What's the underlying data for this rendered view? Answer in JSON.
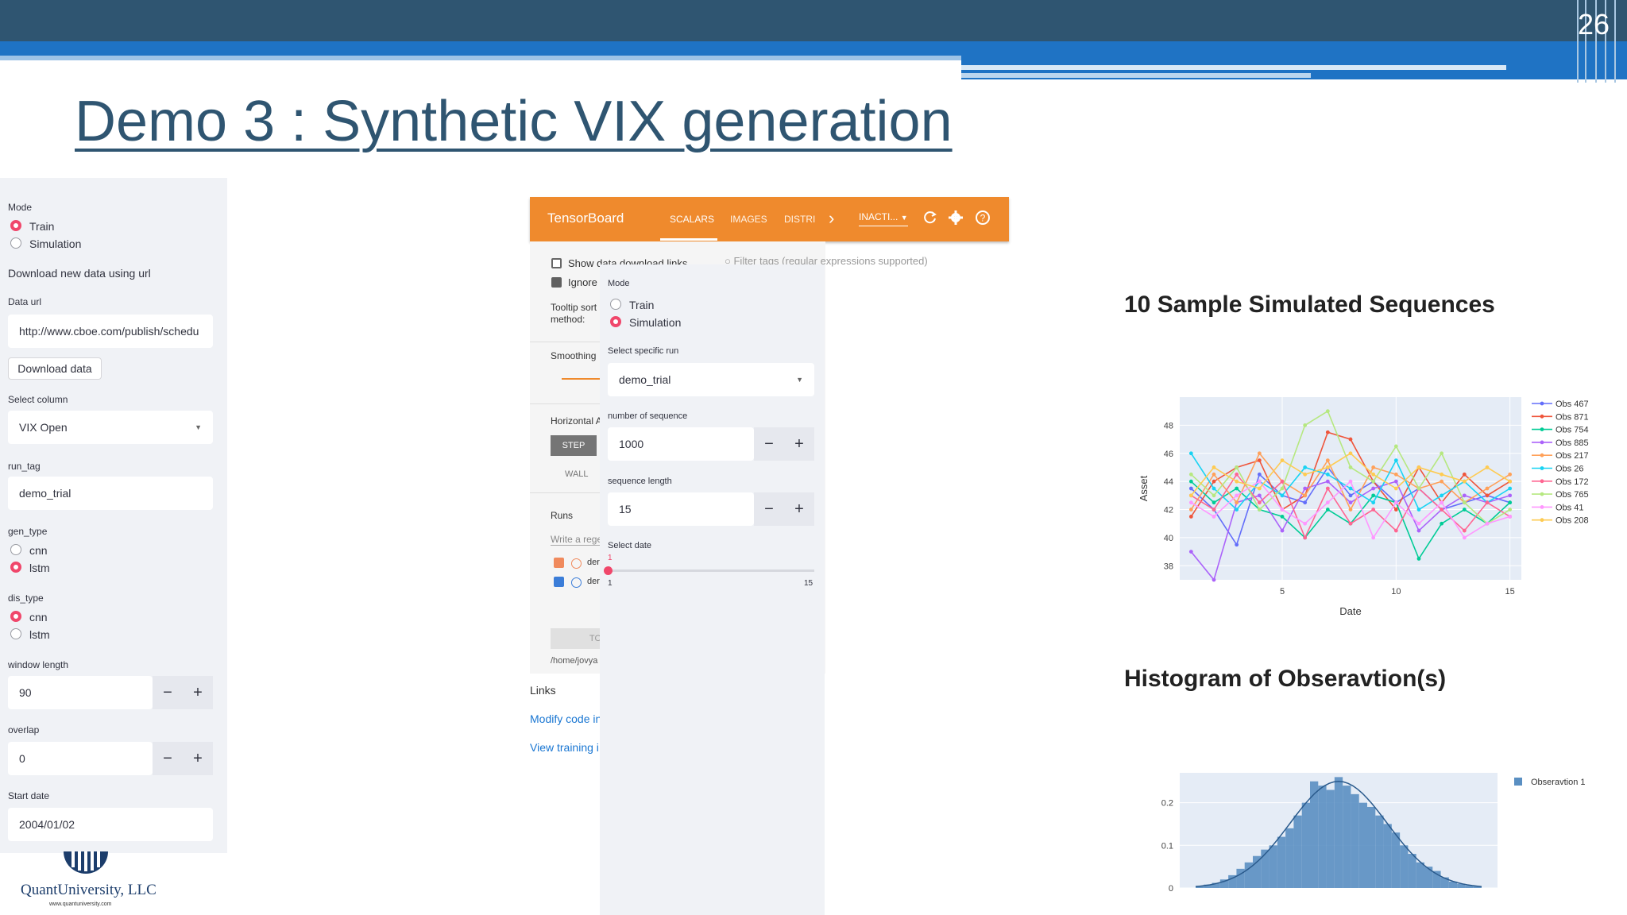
{
  "slide": {
    "page_number": "26",
    "title": "Demo 3 : Synthetic VIX generation",
    "logo_text": "QuantUniversity, LLC",
    "logo_url": "www.quantuniversity.com"
  },
  "left_panel": {
    "mode_label": "Mode",
    "mode_options": [
      "Train",
      "Simulation"
    ],
    "mode_selected": "Train",
    "download_heading": "Download new data using url",
    "data_url_label": "Data url",
    "data_url_value": "http://www.cboe.com/publish/schedu",
    "download_button": "Download data",
    "select_column_label": "Select column",
    "select_column_value": "VIX Open",
    "run_tag_label": "run_tag",
    "run_tag_value": "demo_trial",
    "gen_type_label": "gen_type",
    "gen_type_options": [
      "cnn",
      "lstm"
    ],
    "gen_type_selected": "lstm",
    "dis_type_label": "dis_type",
    "dis_type_options": [
      "cnn",
      "lstm"
    ],
    "dis_type_selected": "cnn",
    "window_length_label": "window length",
    "window_length_value": "90",
    "overlap_label": "overlap",
    "overlap_value": "0",
    "start_date_label": "Start date",
    "start_date_value": "2004/01/02",
    "minus": "−",
    "plus": "+"
  },
  "tensorboard": {
    "brand": "TensorBoard",
    "tabs": [
      "SCALARS",
      "IMAGES",
      "DISTRI"
    ],
    "active_tab": "SCALARS",
    "more": "›",
    "inactive_dropdown": "INACTI...",
    "show_download_links": "Show data download links",
    "ignore": "Ignore",
    "filter_placeholder": "Filter tags (regular expressions supported)",
    "tooltip_sort": "Tooltip sort method:",
    "smoothing": "Smoothing",
    "horizontal_axis": "Horizontal A",
    "step": "STEP",
    "wall": "WALL",
    "runs": "Runs",
    "runs_filter": "Write a rege",
    "run_rows": [
      "der",
      "der"
    ],
    "toggle": "TO",
    "logdir": "/home/jovya",
    "links": "Links",
    "link1": "Modify code in",
    "link2": "View training i"
  },
  "mid_panel": {
    "mode_label": "Mode",
    "mode_options": [
      "Train",
      "Simulation"
    ],
    "mode_selected": "Simulation",
    "select_run_label": "Select specific run",
    "select_run_value": "demo_trial",
    "num_seq_label": "number of sequence",
    "num_seq_value": "1000",
    "seq_len_label": "sequence length",
    "seq_len_value": "15",
    "select_date_label": "Select date",
    "slider_value": "1",
    "slider_min": "1",
    "slider_max": "15",
    "slider_fraction": 0
  },
  "chart_titles": {
    "line": "10 Sample Simulated Sequences",
    "hist": "Histogram of Obseravtion(s)"
  },
  "colors": {
    "accent_red": "#f0476b",
    "tb_orange": "#ef8a2d",
    "header_navy": "#2f5571",
    "header_blue": "#1f73c4"
  },
  "chart_data": [
    {
      "type": "line",
      "title": "10 Sample Simulated Sequences",
      "xlabel": "Date",
      "ylabel": "Asset",
      "xlim": [
        0.5,
        15.5
      ],
      "ylim": [
        37,
        50
      ],
      "x_ticks": [
        "5",
        "10",
        "15"
      ],
      "y_ticks": [
        "38",
        "40",
        "42",
        "44",
        "46",
        "48"
      ],
      "legend_position": "right",
      "x": [
        1,
        2,
        3,
        4,
        5,
        6,
        7,
        8,
        9,
        10,
        11,
        12,
        13,
        14,
        15
      ],
      "series": [
        {
          "name": "Obs 467",
          "color": "#636efa",
          "values": [
            43.5,
            42.0,
            39.5,
            44.5,
            43.0,
            42.5,
            45.0,
            43.0,
            44.0,
            42.5,
            43.5,
            42.0,
            42.5,
            43.0,
            42.5
          ]
        },
        {
          "name": "Obs 871",
          "color": "#ef553b",
          "values": [
            41.5,
            44.0,
            45.0,
            45.5,
            42.0,
            43.0,
            47.5,
            47.0,
            44.0,
            42.0,
            45.0,
            42.5,
            44.5,
            43.0,
            44.0
          ]
        },
        {
          "name": "Obs 754",
          "color": "#00cc96",
          "values": [
            44.0,
            42.5,
            43.5,
            42.0,
            41.5,
            40.0,
            42.0,
            41.0,
            43.0,
            42.5,
            38.5,
            41.0,
            42.0,
            41.0,
            42.5
          ]
        },
        {
          "name": "Obs 885",
          "color": "#ab63fa",
          "values": [
            39.0,
            37.0,
            42.5,
            43.0,
            40.5,
            43.5,
            44.0,
            42.5,
            43.5,
            44.0,
            40.5,
            42.0,
            43.0,
            42.5,
            43.0
          ]
        },
        {
          "name": "Obs 217",
          "color": "#ffa15a",
          "values": [
            42.0,
            44.5,
            42.5,
            46.0,
            44.0,
            43.0,
            45.5,
            42.0,
            45.0,
            44.5,
            43.5,
            44.0,
            42.5,
            43.5,
            44.5
          ]
        },
        {
          "name": "Obs 26",
          "color": "#19d3f3",
          "values": [
            46.0,
            43.5,
            42.0,
            44.0,
            43.0,
            45.0,
            44.5,
            43.5,
            42.5,
            45.5,
            42.0,
            43.0,
            44.0,
            42.5,
            43.5
          ]
        },
        {
          "name": "Obs 172",
          "color": "#ff6692",
          "values": [
            43.0,
            42.0,
            44.5,
            42.5,
            44.0,
            40.0,
            43.5,
            41.0,
            42.0,
            40.5,
            43.5,
            42.0,
            40.5,
            42.5,
            41.5
          ]
        },
        {
          "name": "Obs 765",
          "color": "#b6e880",
          "values": [
            44.5,
            43.0,
            45.0,
            42.0,
            43.5,
            48.0,
            49.0,
            45.0,
            44.0,
            46.5,
            43.5,
            46.0,
            42.5,
            41.0,
            42.0
          ]
        },
        {
          "name": "Obs 41",
          "color": "#ff97ff",
          "values": [
            42.5,
            41.5,
            43.0,
            44.0,
            42.0,
            41.0,
            42.5,
            44.0,
            40.0,
            42.5,
            41.0,
            42.5,
            40.0,
            41.0,
            41.5
          ]
        },
        {
          "name": "Obs 208",
          "color": "#fecb52",
          "values": [
            43.0,
            45.0,
            44.0,
            43.5,
            45.5,
            44.5,
            45.0,
            46.0,
            44.5,
            43.5,
            45.0,
            44.5,
            44.0,
            45.0,
            44.0
          ]
        }
      ]
    },
    {
      "type": "bar",
      "title": "Histogram of Obseravtion(s)",
      "legend": [
        "Obseravtion 1"
      ],
      "legend_position": "top-right",
      "y_ticks": [
        "0",
        "0.1",
        "0.2"
      ],
      "ylim": [
        0,
        0.27
      ],
      "series": [
        {
          "name": "Obseravtion 1",
          "color": "#5a8fc2",
          "values": [
            0.005,
            0.008,
            0.012,
            0.02,
            0.03,
            0.045,
            0.06,
            0.075,
            0.09,
            0.1,
            0.12,
            0.14,
            0.17,
            0.2,
            0.25,
            0.24,
            0.23,
            0.26,
            0.24,
            0.22,
            0.2,
            0.19,
            0.17,
            0.15,
            0.13,
            0.1,
            0.08,
            0.06,
            0.05,
            0.04,
            0.025,
            0.015,
            0.01,
            0.006,
            0.004
          ]
        }
      ],
      "kde": true
    }
  ]
}
